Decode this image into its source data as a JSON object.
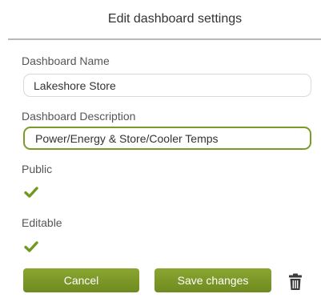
{
  "dialog": {
    "title": "Edit dashboard settings"
  },
  "form": {
    "name_label": "Dashboard Name",
    "name_value": "Lakeshore Store",
    "description_label": "Dashboard Description",
    "description_value": "Power/Energy & Store/Cooler Temps",
    "public_label": "Public",
    "public_checked": true,
    "editable_label": "Editable",
    "editable_checked": true
  },
  "actions": {
    "cancel_label": "Cancel",
    "save_label": "Save changes",
    "delete_icon": "trash-icon"
  },
  "colors": {
    "accent": "#7b9525",
    "check": "#6f9a1d",
    "focus_border": "#7a9b2a"
  }
}
